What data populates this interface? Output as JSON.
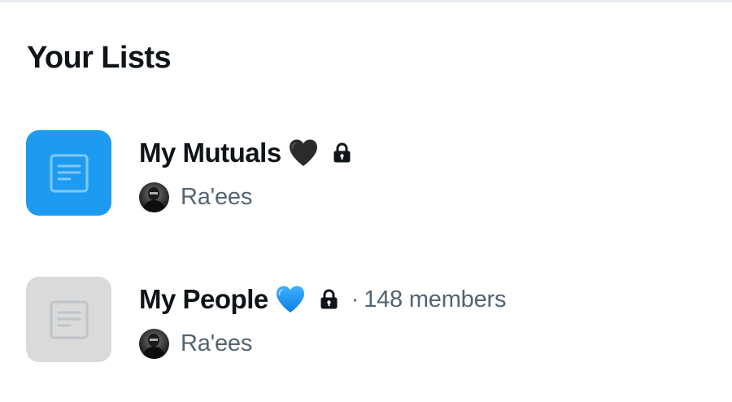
{
  "section": {
    "title": "Your Lists"
  },
  "lists": [
    {
      "name": "My Mutuals",
      "emoji_icon": "black-heart-icon",
      "private": true,
      "thumbnail_color": "#1d9bf0",
      "owner": "Ra'ees",
      "members": null
    },
    {
      "name": "My People",
      "emoji_icon": "blue-heart-icon",
      "private": true,
      "thumbnail_color": "#dadada",
      "owner": "Ra'ees",
      "members_dot": "·",
      "members": "148 members"
    }
  ],
  "colors": {
    "primary_text": "#0f1419",
    "secondary_text": "#536471",
    "accent": "#1d9bf0"
  }
}
